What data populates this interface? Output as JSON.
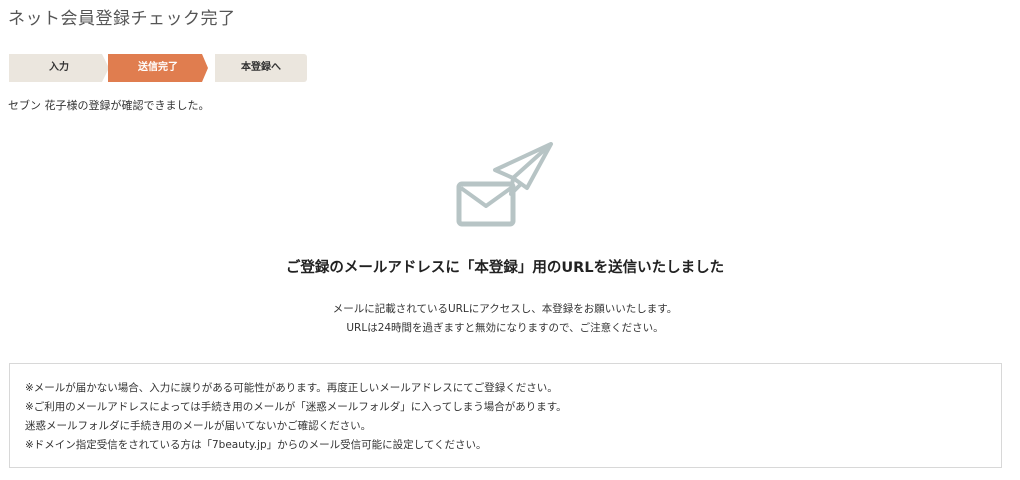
{
  "page": {
    "title": "ネット会員登録チェック完了"
  },
  "steps": [
    {
      "label": "入力",
      "state": "done"
    },
    {
      "label": "送信完了",
      "state": "current"
    },
    {
      "label": "本登録へ",
      "state": "upcoming"
    }
  ],
  "colors": {
    "accent": "#e07d4f",
    "step_inactive": "#ebe6de",
    "icon": "#b7c4c5"
  },
  "confirmation": {
    "text": "セブン 花子様の登録が確認できました。"
  },
  "main": {
    "icon": "paper-plane-envelope-icon",
    "heading": "ご登録のメールアドレスに「本登録」用のURLを送信いたしました",
    "description_line1": "メールに記載されているURLにアクセスし、本登録をお願いいたします。",
    "description_line2": "URLは24時間を過ぎますと無効になりますので、ご注意ください。"
  },
  "notice": {
    "lines": [
      "※メールが届かない場合、入力に誤りがある可能性があります。再度正しいメールアドレスにてご登録ください。",
      "※ご利用のメールアドレスによっては手続き用のメールが「迷惑メールフォルダ」に入ってしまう場合があります。",
      "迷惑メールフォルダに手続き用のメールが届いてないかご確認ください。",
      "※ドメイン指定受信をされている方は「7beauty.jp」からのメール受信可能に設定してください。"
    ]
  }
}
